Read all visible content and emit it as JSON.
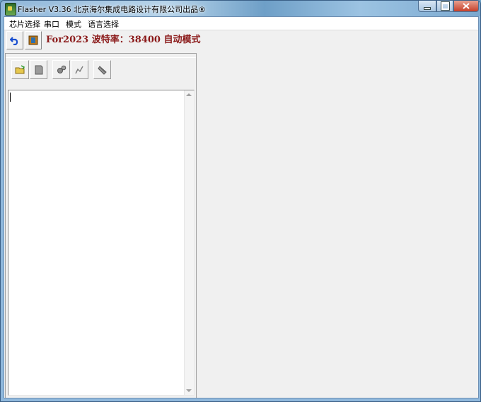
{
  "window": {
    "title": "Flasher V3.36  北京海尔集成电路设计有限公司出品®"
  },
  "menu": {
    "items": [
      {
        "label": "芯片选择"
      },
      {
        "label": "串口"
      },
      {
        "label": "模式"
      },
      {
        "label": "语言选择"
      }
    ]
  },
  "toolbar": {
    "status": "For2023 波特率：38400 自动模式",
    "status_color": "#8b1a1a"
  },
  "log": {
    "content": ""
  },
  "colors": {
    "background": "#f0f0f0",
    "accent": "#8b1a1a"
  }
}
